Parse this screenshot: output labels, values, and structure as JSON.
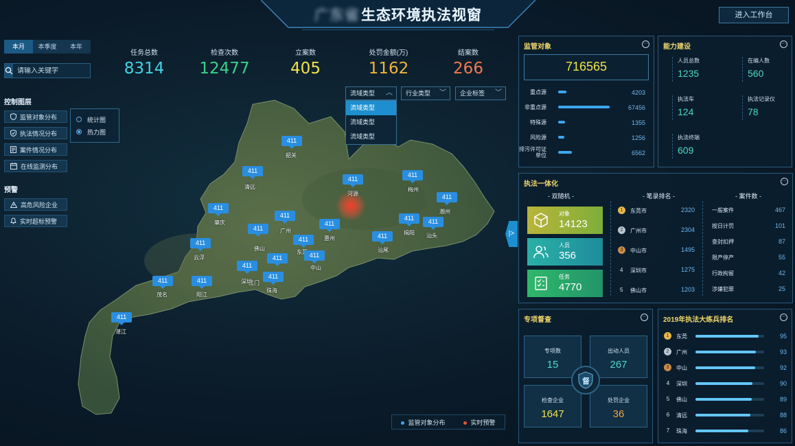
{
  "header": {
    "title_prefix": "广东省",
    "title": "生态环境执法视窗",
    "workbench_label": "进入工作台"
  },
  "period_tabs": [
    "本月",
    "本季度",
    "本年"
  ],
  "search": {
    "placeholder": "请输入关键字"
  },
  "layers": {
    "heading": "控制图层",
    "items": [
      "监管对象分布",
      "执法情况分布",
      "案件情况分布",
      "在线监测分布"
    ],
    "sub_options": [
      "统计图",
      "热力图"
    ],
    "sub_selected": "热力图"
  },
  "warning": {
    "heading": "预警",
    "items": [
      "高危风险企业",
      "实时超标预警"
    ]
  },
  "stats": [
    {
      "label": "任务总数",
      "value": "8314",
      "color": "#3fd6e6"
    },
    {
      "label": "检查次数",
      "value": "12477",
      "color": "#36d38c"
    },
    {
      "label": "立案数",
      "value": "405",
      "color": "#f2e24a"
    },
    {
      "label": "处罚金额(万)",
      "value": "1162",
      "color": "#f2b43c"
    },
    {
      "label": "结案数",
      "value": "266",
      "color": "#f07a4e"
    }
  ],
  "filters": {
    "basin": "流域类型",
    "industry": "行业类型",
    "enterprise": "企业标签",
    "basin_options": [
      "流域类型",
      "流域类型",
      "流域类型"
    ]
  },
  "map": {
    "pin_value": "411",
    "cities": [
      "韶关",
      "清远",
      "河源",
      "梅州",
      "潮州",
      "肇庆",
      "广州",
      "惠州",
      "揭阳",
      "汕头",
      "佛山",
      "东莞",
      "汕尾",
      "云浮",
      "中山",
      "深圳",
      "江门",
      "茂名",
      "阳江",
      "珠海",
      "湛江"
    ],
    "legend": [
      "监管对象分布",
      "实时预警"
    ],
    "legend_colors": [
      "#3ea6ee",
      "#e8503a"
    ]
  },
  "supervision": {
    "title": "监管对象",
    "total": "716565",
    "rows": [
      {
        "label": "重点源",
        "value": "4203",
        "fill": 0.12
      },
      {
        "label": "非重点源",
        "value": "67456",
        "fill": 0.75
      },
      {
        "label": "特殊源",
        "value": "1355",
        "fill": 0.1
      },
      {
        "label": "风险源",
        "value": "1256",
        "fill": 0.09
      },
      {
        "label": "排污许可证单位",
        "value": "6562",
        "fill": 0.2
      }
    ]
  },
  "capacity": {
    "title": "能力建设",
    "items": [
      {
        "label": "人员总数",
        "value": "1235"
      },
      {
        "label": "在编人数",
        "value": "560"
      },
      {
        "label": "执法车",
        "value": "124"
      },
      {
        "label": "执法记录仪",
        "value": "78"
      },
      {
        "label": "执法终端",
        "value": "609"
      }
    ]
  },
  "enforcement": {
    "title": "执法一体化",
    "col1": "- 双随机 -",
    "col2": "- 笔录排名 -",
    "col3": "- 案件数 -",
    "tiles": [
      {
        "label": "对象",
        "value": "14123"
      },
      {
        "label": "人员",
        "value": "356"
      },
      {
        "label": "任务",
        "value": "4770"
      }
    ],
    "ranking": [
      {
        "rank": "1",
        "city": "东莞市",
        "value": "2320"
      },
      {
        "rank": "2",
        "city": "广州市",
        "value": "2304"
      },
      {
        "rank": "3",
        "city": "中山市",
        "value": "1495"
      },
      {
        "rank": "4",
        "city": "深圳市",
        "value": "1275"
      },
      {
        "rank": "5",
        "city": "佛山市",
        "value": "1203"
      }
    ],
    "cases": [
      {
        "label": "一般案件",
        "value": "467"
      },
      {
        "label": "按日计罚",
        "value": "101"
      },
      {
        "label": "查封扣押",
        "value": "87"
      },
      {
        "label": "限产停产",
        "value": "55"
      },
      {
        "label": "行政拘留",
        "value": "42"
      },
      {
        "label": "涉嫌犯罪",
        "value": "25"
      }
    ]
  },
  "special": {
    "title": "专项督查",
    "badge": "督",
    "boxes": [
      {
        "label": "专项数",
        "value": "15",
        "color": "#4dd8c7"
      },
      {
        "label": "出动人员",
        "value": "267",
        "color": "#4dd8c7"
      },
      {
        "label": "检查企业",
        "value": "1647",
        "color": "#f2e24a"
      },
      {
        "label": "处罚企业",
        "value": "36",
        "color": "#f2a23c"
      }
    ]
  },
  "drill": {
    "title": "2019年执法大练兵排名",
    "rows": [
      {
        "rank": "1",
        "city": "东莞",
        "value": "95"
      },
      {
        "rank": "2",
        "city": "广州",
        "value": "93"
      },
      {
        "rank": "3",
        "city": "中山",
        "value": "92"
      },
      {
        "rank": "4",
        "city": "深圳",
        "value": "90"
      },
      {
        "rank": "5",
        "city": "佛山",
        "value": "89"
      },
      {
        "rank": "6",
        "city": "清远",
        "value": "88"
      },
      {
        "rank": "7",
        "city": "珠海",
        "value": "86"
      }
    ]
  }
}
